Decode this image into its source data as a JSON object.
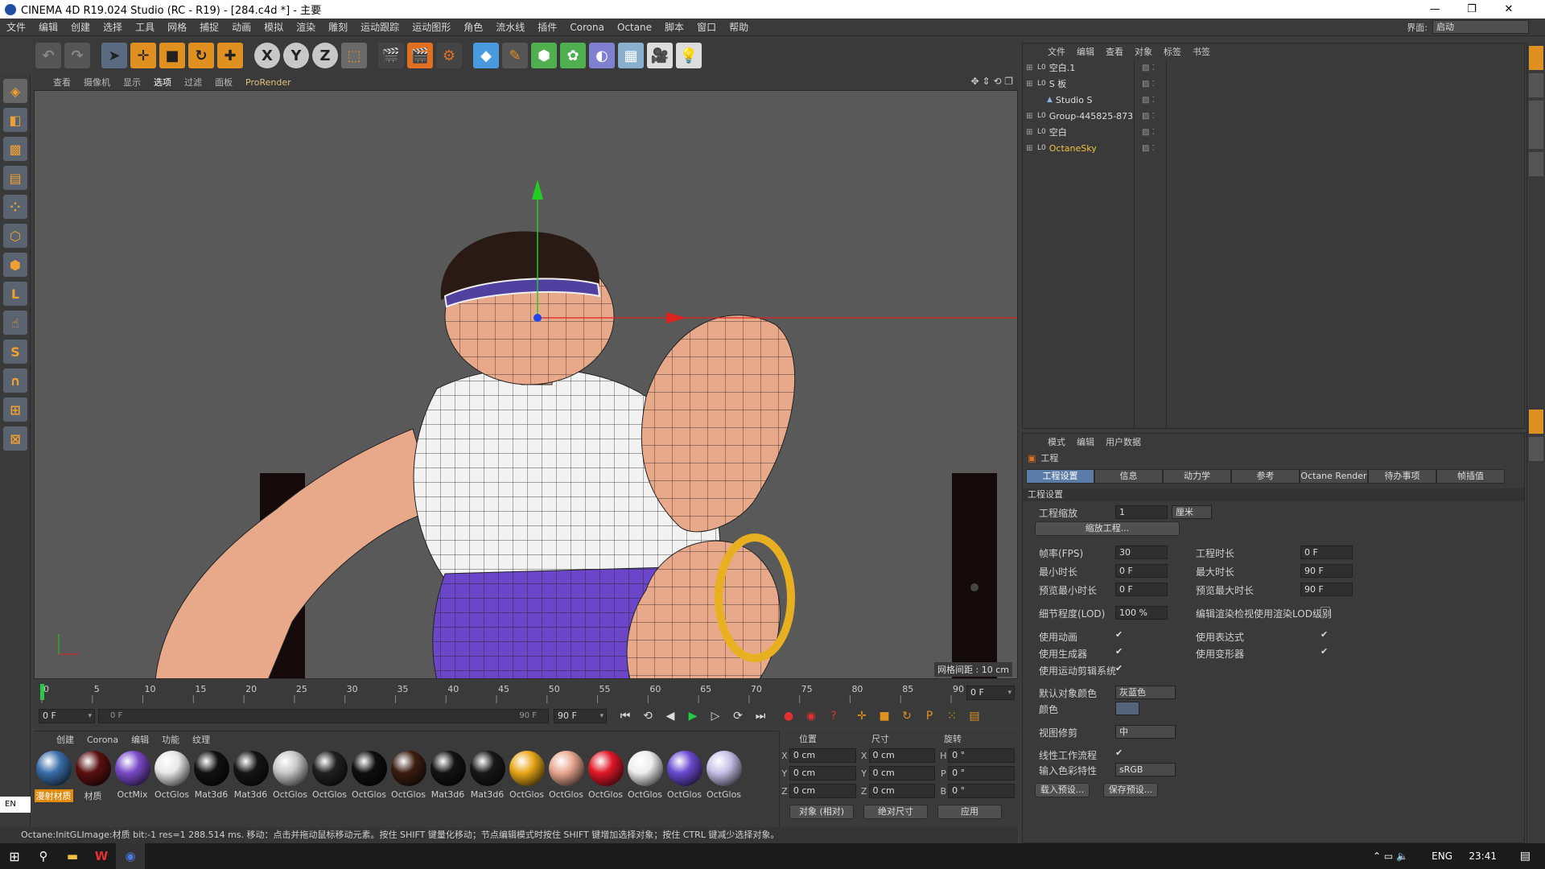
{
  "window": {
    "title": "CINEMA 4D R19.024 Studio (RC - R19) - [284.c4d *] - 主要"
  },
  "menubar": {
    "items": [
      "文件",
      "编辑",
      "创建",
      "选择",
      "工具",
      "网格",
      "捕捉",
      "动画",
      "模拟",
      "渲染",
      "雕刻",
      "运动跟踪",
      "运动图形",
      "角色",
      "流水线",
      "插件",
      "Corona",
      "Octane",
      "脚本",
      "窗口",
      "帮助"
    ],
    "layout_label": "界面:",
    "layout_value": "启动"
  },
  "viewport": {
    "menu": [
      "查看",
      "摄像机",
      "显示",
      "选项",
      "过滤",
      "面板"
    ],
    "renderer": "ProRender",
    "grid_info": "网格间距 : 10 cm"
  },
  "timeline": {
    "ticks": [
      "0",
      "5",
      "10",
      "15",
      "20",
      "25",
      "30",
      "35",
      "40",
      "45",
      "50",
      "55",
      "60",
      "65",
      "70",
      "75",
      "80",
      "85",
      "90"
    ],
    "current_frame": "0 F"
  },
  "timectrl": {
    "start": "0 F",
    "range_start": "0 F",
    "range_end": "90 F",
    "end": "90 F"
  },
  "materials": {
    "menu": [
      "创建",
      "Corona",
      "编辑",
      "功能",
      "纹理"
    ],
    "items": [
      {
        "label": "漫射材质",
        "color": "#3a6ea8",
        "selected": true
      },
      {
        "label": "材质",
        "color": "#5a1010",
        "selected": false
      },
      {
        "label": "OctMix",
        "color": "#7a4ac8",
        "selected": false
      },
      {
        "label": "OctGlos",
        "color": "#e8e8e8",
        "selected": false
      },
      {
        "label": "Mat3d6",
        "color": "#111111",
        "selected": false
      },
      {
        "label": "Mat3d6",
        "color": "#151515",
        "selected": false
      },
      {
        "label": "OctGlos",
        "color": "#c8c8c8",
        "selected": false
      },
      {
        "label": "OctGlos",
        "color": "#202020",
        "selected": false
      },
      {
        "label": "OctGlos",
        "color": "#0e0e0e",
        "selected": false
      },
      {
        "label": "OctGlos",
        "color": "#3a1e10",
        "selected": false
      },
      {
        "label": "Mat3d6",
        "color": "#131313",
        "selected": false
      },
      {
        "label": "Mat3d6",
        "color": "#181818",
        "selected": false
      },
      {
        "label": "OctGlos",
        "color": "#e8a818",
        "selected": false
      },
      {
        "label": "OctGlos",
        "color": "#e8a890",
        "selected": false
      },
      {
        "label": "OctGlos",
        "color": "#e01828",
        "selected": false
      },
      {
        "label": "OctGlos",
        "color": "#eeeeee",
        "selected": false
      },
      {
        "label": "OctGlos",
        "color": "#6a4ad0",
        "selected": false
      },
      {
        "label": "OctGlos",
        "color": "#c8c0e8",
        "selected": false
      }
    ]
  },
  "coords": {
    "headers": [
      "位置",
      "尺寸",
      "旋转"
    ],
    "rows": [
      {
        "a": "X",
        "pos": "0 cm",
        "b": "X",
        "size": "0 cm",
        "c": "H",
        "rot": "0 °"
      },
      {
        "a": "Y",
        "pos": "0 cm",
        "b": "Y",
        "size": "0 cm",
        "c": "P",
        "rot": "0 °"
      },
      {
        "a": "Z",
        "pos": "0 cm",
        "b": "Z",
        "size": "0 cm",
        "c": "B",
        "rot": "0 °"
      }
    ],
    "mode": "对象 (相对)",
    "size_mode": "绝对尺寸",
    "apply": "应用"
  },
  "status": {
    "text": "Octane:InitGLImage:材质 bit:-1 res=1 288.514 ms.    移动：点击并拖动鼠标移动元素。按住 SHIFT 键量化移动；节点编辑模式时按住 SHIFT 键增加选择对象；按住 CTRL 键减少选择对象。"
  },
  "object_manager": {
    "menu": [
      "文件",
      "编辑",
      "查看",
      "对象",
      "标签",
      "书签"
    ],
    "objects": [
      {
        "name": "空白.1",
        "indent": 0,
        "color": "#ddd"
      },
      {
        "name": "S 板",
        "indent": 0,
        "color": "#ddd"
      },
      {
        "name": "Studio S",
        "indent": 1,
        "color": "#ddd"
      },
      {
        "name": "Group-445825-873",
        "indent": 0,
        "color": "#ddd"
      },
      {
        "name": "空白",
        "indent": 0,
        "color": "#ddd"
      },
      {
        "name": "OctaneSky",
        "indent": 0,
        "color": "#f0c040"
      }
    ]
  },
  "attributes": {
    "menu": [
      "模式",
      "编辑",
      "用户数据"
    ],
    "section": "工程",
    "tabs": [
      "工程设置",
      "信息",
      "动力学",
      "参考",
      "Octane Render",
      "待办事项",
      "帧插值"
    ],
    "group": "工程设置",
    "scale_label": "工程缩放",
    "scale_value": "1",
    "scale_unit": "厘米",
    "scale_btn": "缩放工程...",
    "fps_label": "帧率(FPS)",
    "fps_value": "30",
    "proj_len_label": "工程时长",
    "proj_len_value": "0 F",
    "min_len_label": "最小时长",
    "min_len_value": "0 F",
    "max_len_label": "最大时长",
    "max_len_value": "90 F",
    "pmin_label": "预览最小时长",
    "pmin_value": "0 F",
    "pmax_label": "预览最大时长",
    "pmax_value": "90 F",
    "lod_label": "细节程度(LOD)",
    "lod_value": "100 %",
    "lod_check_label": "编辑渲染检视使用渲染LOD级别",
    "use_anim": "使用动画",
    "use_expr": "使用表达式",
    "use_gen": "使用生成器",
    "use_deform": "使用变形器",
    "use_motion": "使用运动剪辑系统",
    "def_color_label": "默认对象颜色",
    "def_color_value": "灰蓝色",
    "color_label": "颜色",
    "view_clip_label": "视图修剪",
    "view_clip_value": "中",
    "linear_label": "线性工作流程",
    "input_color_label": "输入色彩特性",
    "input_color_value": "sRGB",
    "load_preset": "载入预设...",
    "save_preset": "保存预设..."
  },
  "taskbar": {
    "lang": "ENG",
    "time": "23:41",
    "ime": "EN"
  }
}
